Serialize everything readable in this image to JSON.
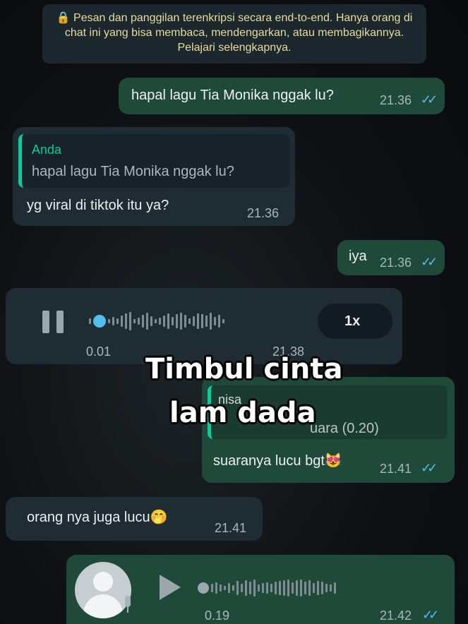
{
  "encryption_notice": "🔒 Pesan dan panggilan terenkripsi secara end-to-end. Hanya orang di chat ini yang bisa membaca, mendengarkan, atau membagikannya. Pelajari selengkapnya.",
  "messages": [
    {
      "dir": "out",
      "text": "hapal lagu Tia Monika nggak lu?",
      "time": "21.36",
      "ticks": "✓✓"
    },
    {
      "dir": "in",
      "quote_author": "Anda",
      "quote_text": "hapal lagu Tia Monika nggak lu?",
      "text": "yg viral di tiktok itu ya?",
      "time": "21.36"
    },
    {
      "dir": "out",
      "text": "iya",
      "time": "21.36",
      "ticks": "✓✓"
    },
    {
      "dir": "in",
      "type": "voice",
      "elapsed": "0.01",
      "time": "21.38",
      "speed": "1x"
    },
    {
      "dir": "out",
      "quote_author": "nisa",
      "quote_text": "uara (0.20)",
      "text": "suaranya lucu bgt😻",
      "time": "21.41",
      "ticks": "✓✓"
    },
    {
      "dir": "in",
      "text": "orang nya juga lucu🤭",
      "time": "21.41"
    },
    {
      "dir": "out",
      "type": "voice",
      "elapsed": "0.19",
      "time": "21.42",
      "ticks": "✓✓"
    }
  ],
  "overlay": {
    "line1": "Timbul cinta",
    "line2": "lam dada"
  },
  "icons": {
    "pause": "pause-icon",
    "play": "play-icon",
    "avatar": "avatar-icon",
    "mic": "mic-icon",
    "lock": "lock-icon"
  },
  "colors": {
    "outgoing": "#1f4a3a",
    "incoming": "#202c33",
    "ticks": "#53bdeb",
    "quote_bar": "#06cf9c",
    "notice_text": "#e6dc9c"
  }
}
